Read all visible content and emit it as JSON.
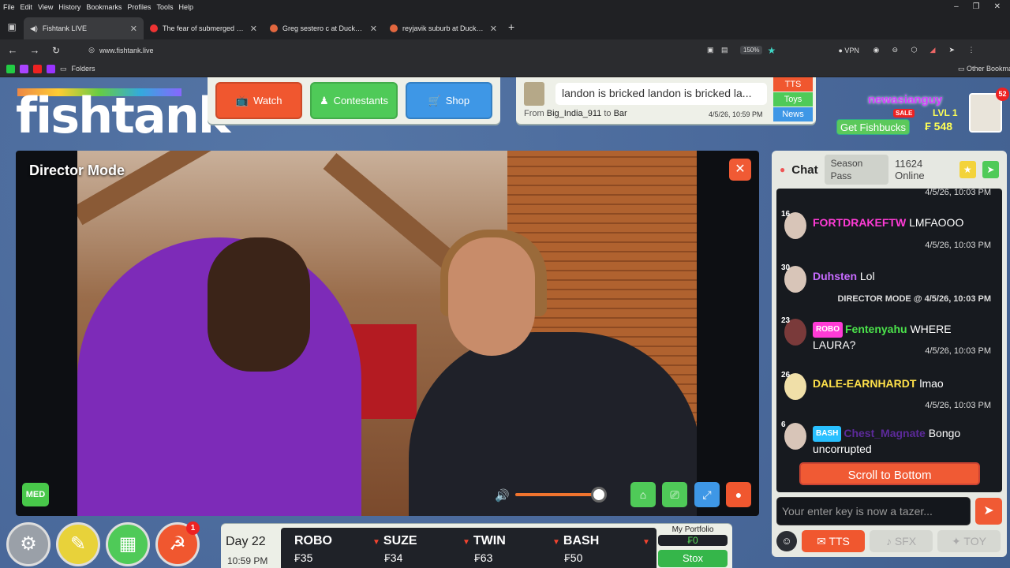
{
  "browser": {
    "menu": [
      "File",
      "Edit",
      "View",
      "History",
      "Bookmarks",
      "Profiles",
      "Tools",
      "Help"
    ],
    "tabs": [
      {
        "label": "Fishtank LIVE",
        "active": true
      },
      {
        "label": "The fear of submerged machine",
        "active": false
      },
      {
        "label": "Greg sestero c at DuckDuckGo",
        "active": false
      },
      {
        "label": "reyjavik suburb at DuckDuckGo",
        "active": false
      }
    ],
    "url": "www.fishtank.live",
    "zoom": "150%",
    "vpn": "VPN",
    "bookmarks_folder": "Folders",
    "other_bookmarks": "Other Bookmarks"
  },
  "logo": {
    "text": "fishtank",
    "reg": "©"
  },
  "nav": {
    "watch": "Watch",
    "contestants": "Contestants",
    "shop": "Shop"
  },
  "ticker": {
    "message": "landon is bricked landon is bricked la...",
    "from_label": "From",
    "from_user": "Big_India_911",
    "to_label": "to",
    "to_target": "Bar",
    "time": "4/5/26, 10:59 PM",
    "modes": [
      "TTS",
      "Toys",
      "News"
    ]
  },
  "user": {
    "name": "newasianguy",
    "sale": "SALE",
    "level": "LVL 1",
    "get_fishbucks": "Get Fishbucks",
    "balance": "₣ 548",
    "notifications": "52"
  },
  "player": {
    "mode": "Director Mode",
    "quality": "MED",
    "volume": 0.9
  },
  "chat": {
    "title": "Chat",
    "season_pass": "Season Pass",
    "online": "11624 Online",
    "top_time": "4/5/26, 10:03 PM",
    "messages": [
      {
        "level": "16",
        "name": "FORTDRAKEFTW",
        "name_color": "#ff3bd6",
        "text": "LMFAOOO",
        "time": "4/5/26, 10:03 PM",
        "badge": "",
        "badge_color": ""
      },
      {
        "level": "30",
        "name": "Duhsten",
        "name_color": "#c76bff",
        "text": "Lol",
        "time": "DIRECTOR MODE @ 4/5/26, 10:03 PM",
        "badge": "",
        "badge_color": ""
      },
      {
        "level": "23",
        "name": "Fentenyahu",
        "name_color": "#4be34b",
        "text": "WHERE LAURA?",
        "time": "4/5/26, 10:03 PM",
        "badge": "ROBO",
        "badge_color": "#ff3bd6"
      },
      {
        "level": "26",
        "name": "DALE-EARNHARDT",
        "name_color": "#ffe14a",
        "text": "lmao",
        "time": "4/5/26, 10:03 PM",
        "badge": "",
        "badge_color": ""
      },
      {
        "level": "6",
        "name": "Chest_Magnate",
        "name_color": "#5c2a9a",
        "text": "Bongo uncorrupted",
        "time": "",
        "badge": "BASH",
        "badge_color": "#29c0ff"
      }
    ],
    "scroll_to_bottom": "Scroll to Bottom",
    "input_placeholder": "Your enter key is now a tazer...",
    "footer": {
      "tts": "TTS",
      "sfx": "SFX",
      "toy": "TOY"
    }
  },
  "dock": {
    "badge": "1"
  },
  "stocks": {
    "day": "Day 22",
    "time": "10:59 PM",
    "items": [
      {
        "name": "ROBO",
        "price": "₣35",
        "down": false
      },
      {
        "name": "SUZE",
        "price": "₣34",
        "down": true
      },
      {
        "name": "TWIN",
        "price": "₣63",
        "down": true
      },
      {
        "name": "BASH",
        "price": "₣50",
        "down": true
      }
    ],
    "portfolio_label": "My Portfolio",
    "portfolio_value": "₣0",
    "stox": "Stox"
  }
}
